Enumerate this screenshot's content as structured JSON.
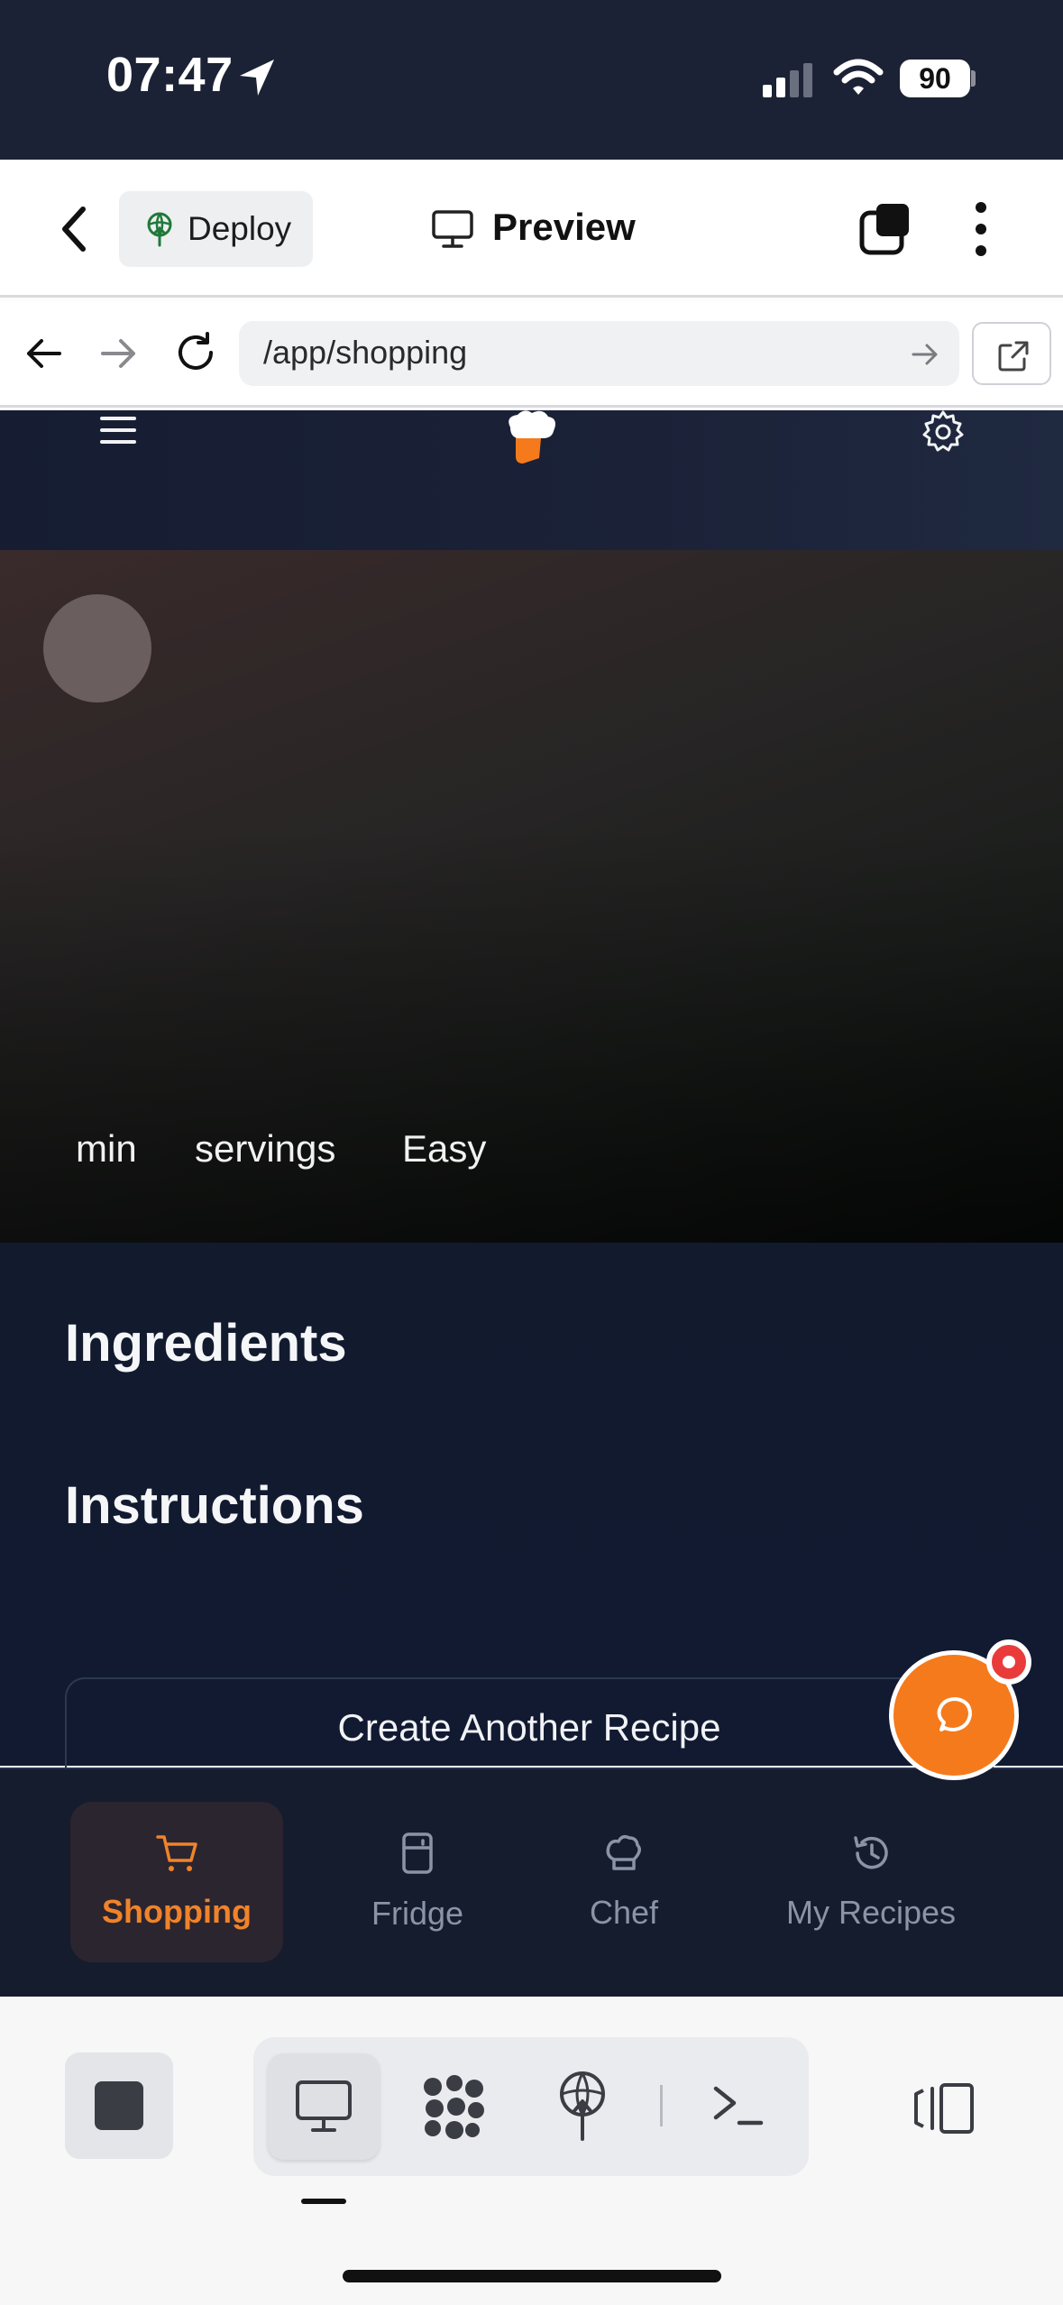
{
  "status_bar": {
    "time": "07:47",
    "battery": "90"
  },
  "top_bar": {
    "deploy_label": "Deploy",
    "preview_label": "Preview"
  },
  "url_bar": {
    "url": "/app/shopping"
  },
  "recipe": {
    "meta": [
      "min",
      "servings",
      "Easy"
    ],
    "ingredients_heading": "Ingredients",
    "instructions_heading": "Instructions",
    "create_another_label": "Create Another Recipe"
  },
  "bottom_nav": {
    "items": [
      {
        "label": "Shopping",
        "icon": "cart-icon",
        "active": true
      },
      {
        "label": "Fridge",
        "icon": "fridge-icon",
        "active": false
      },
      {
        "label": "Chef",
        "icon": "chef-hat-icon",
        "active": false
      },
      {
        "label": "My Recipes",
        "icon": "history-icon",
        "active": false
      }
    ]
  },
  "colors": {
    "accent": "#f57a1c",
    "notification": "#ea3b3b",
    "active_nav_text": "#f0832a"
  }
}
